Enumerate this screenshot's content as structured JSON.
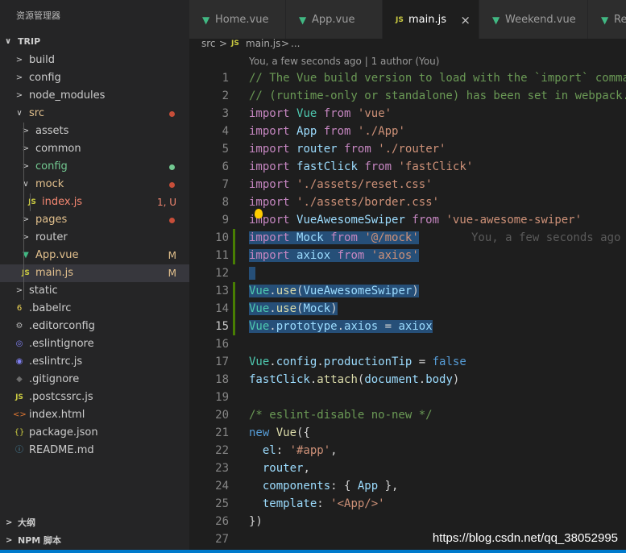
{
  "sidebar": {
    "title": "资源管理器",
    "root": "TRIP",
    "tree": [
      {
        "label": "build",
        "icon": "chevron-right",
        "badge": "",
        "color": "#cccccc"
      },
      {
        "label": "config",
        "icon": "chevron-right",
        "badge": "",
        "color": "#cccccc"
      },
      {
        "label": "node_modules",
        "icon": "chevron-right",
        "badge": "",
        "color": "#cccccc"
      },
      {
        "label": "src",
        "icon": "chevron-down",
        "badge": "",
        "color": "#e2c08d"
      },
      {
        "label": "assets",
        "icon": "chevron-right",
        "badge": "",
        "color": "#cccccc"
      },
      {
        "label": "common",
        "icon": "chevron-right",
        "badge": "",
        "color": "#cccccc"
      },
      {
        "label": "config",
        "icon": "chevron-right",
        "badge": "",
        "color": "#73c991"
      },
      {
        "label": "mock",
        "icon": "chevron-down",
        "badge": "",
        "color": "#e2c08d"
      },
      {
        "label": "index.js",
        "icon": "js",
        "badge": "1, U",
        "color": "#f48771"
      },
      {
        "label": "pages",
        "icon": "chevron-right",
        "badge": "",
        "color": "#e2c08d"
      },
      {
        "label": "router",
        "icon": "chevron-right",
        "badge": "",
        "color": "#cccccc"
      },
      {
        "label": "App.vue",
        "icon": "vue",
        "badge": "M",
        "color": "#e2c08d"
      },
      {
        "label": "main.js",
        "icon": "js",
        "badge": "M",
        "color": "#e2c08d"
      },
      {
        "label": "static",
        "icon": "chevron-right",
        "badge": "",
        "color": "#cccccc"
      },
      {
        "label": ".babelrc",
        "icon": "babel",
        "badge": "",
        "color": "#cccccc"
      },
      {
        "label": ".editorconfig",
        "icon": "gear",
        "badge": "",
        "color": "#cccccc"
      },
      {
        "label": ".eslintignore",
        "icon": "eslint",
        "badge": "",
        "color": "#cccccc"
      },
      {
        "label": ".eslintrc.js",
        "icon": "eslint-js",
        "badge": "",
        "color": "#cccccc"
      },
      {
        "label": ".gitignore",
        "icon": "git",
        "badge": "",
        "color": "#cccccc"
      },
      {
        "label": ".postcssrc.js",
        "icon": "js",
        "badge": "",
        "color": "#cccccc"
      },
      {
        "label": "index.html",
        "icon": "html",
        "badge": "",
        "color": "#cccccc"
      },
      {
        "label": "package.json",
        "icon": "json",
        "badge": "",
        "color": "#cccccc"
      },
      {
        "label": "README.md",
        "icon": "info",
        "badge": "",
        "color": "#cccccc"
      }
    ],
    "bottom_sections": [
      "大纲",
      "NPM 脚本"
    ]
  },
  "tabs": [
    {
      "label": "Home.vue",
      "icon": "vue",
      "active": false
    },
    {
      "label": "App.vue",
      "icon": "vue",
      "active": false
    },
    {
      "label": "main.js",
      "icon": "js",
      "active": true,
      "close": "×"
    },
    {
      "label": "Weekend.vue",
      "icon": "vue",
      "active": false
    },
    {
      "label": "Re",
      "icon": "vue",
      "active": false
    }
  ],
  "breadcrumb": {
    "folder": "src",
    "sep": ">",
    "file": "main.js",
    "more": "...",
    "file_icon": "JS"
  },
  "codelens": "You, a few seconds ago | 1 author (You)",
  "inline_blame": "You, a few seconds ago",
  "code_lines": [
    "// The Vue build version to load with the `import` command",
    "// (runtime-only or standalone) has been set in webpack.base.conf with an alias.",
    "import Vue from 'vue'",
    "import App from './App'",
    "import router from './router'",
    "import fastClick from 'fastClick'",
    "import './assets/reset.css'",
    "import './assets/border.css'",
    "import VueAwesomeSwiper from 'vue-awesome-swiper'",
    "import Mock from '@/mock'",
    "import axiox from 'axios'",
    "",
    "Vue.use(VueAwesomeSwiper)",
    "Vue.use(Mock)",
    "Vue.prototype.$axios = axiox",
    "",
    "Vue.config.productionTip = false",
    "fastClick.attach(document.body)",
    "",
    "/* eslint-disable no-new */",
    "new Vue({",
    "  el: '#app',",
    "  router,",
    "  components: { App },",
    "  template: '<App/>'",
    "})",
    ""
  ],
  "watermark": "https://blog.csdn.net/qq_38052995",
  "colors": {
    "accent": "#007acc",
    "modified": "#e2c08d",
    "untracked": "#73c991",
    "error": "#f48771",
    "selection": "#264f78"
  }
}
